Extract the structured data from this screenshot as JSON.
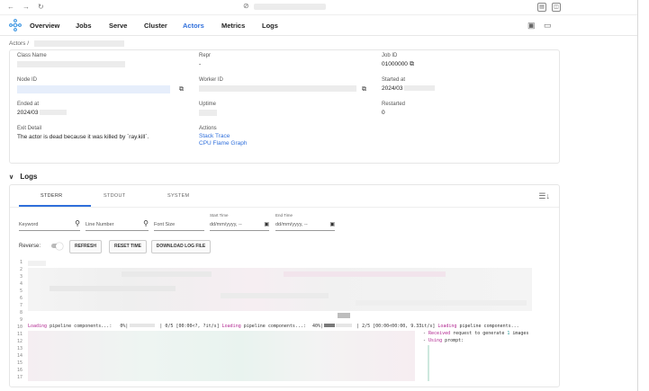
{
  "nav": {
    "tabs": [
      {
        "label": "Overview"
      },
      {
        "label": "Jobs"
      },
      {
        "label": "Serve"
      },
      {
        "label": "Cluster"
      },
      {
        "label": "Actors"
      },
      {
        "label": "Metrics"
      },
      {
        "label": "Logs"
      }
    ],
    "active": "Actors"
  },
  "breadcrumb": {
    "root": "Actors",
    "sep": "/"
  },
  "actor": {
    "class_name_label": "Class Name",
    "repr_label": "Repr",
    "repr_value": "-",
    "job_id_label": "Job ID",
    "job_id_value": "01000000",
    "node_id_label": "Node ID",
    "worker_id_label": "Worker ID",
    "started_at_label": "Started at",
    "started_at_value": "2024/03",
    "ended_at_label": "Ended at",
    "ended_at_value": "2024/03",
    "uptime_label": "Uptime",
    "restarted_label": "Restarted",
    "restarted_value": "0",
    "exit_detail_label": "Exit Detail",
    "exit_detail_value": "The actor is dead because it was killed by `ray.kill`.",
    "actions_label": "Actions",
    "action_stack_trace": "Stack Trace",
    "action_flame_graph": "CPU Flame Graph"
  },
  "logs": {
    "section_title": "Logs",
    "tabs": [
      "STDERR",
      "STDOUT",
      "SYSTEM"
    ],
    "filters": {
      "keyword_placeholder": "Keyword",
      "line_number_placeholder": "Line Number",
      "font_size_placeholder": "Font Size",
      "start_time_label": "Start Time",
      "start_time_value": "dd/mm/yyyy, --",
      "end_time_label": "End Time",
      "end_time_value": "dd/mm/yyyy, --"
    },
    "reverse_label": "Reverse:",
    "buttons": {
      "refresh": "REFRESH",
      "reset_time": "RESET TIME",
      "download": "DOWNLOAD LOG FILE"
    },
    "line_numbers": [
      "1",
      "2",
      "3",
      "4",
      "5",
      "6",
      "7",
      "8",
      "9",
      "10",
      "11",
      "12",
      "13",
      "14",
      "15",
      "16",
      "17"
    ],
    "line10": {
      "seg1_mag": "Loading",
      "seg1_rest": " pipeline components...:",
      "seg2": "0%|",
      "seg3": "| 0/5 [00:00<?, ?it/s]",
      "seg4_mag": "Loading",
      "seg4_rest": " pipeline components...:",
      "seg5": "40%|",
      "seg6": "| 2/5 [00:00<00:00, 9.33it/s]",
      "seg7_mag": "Loading",
      "seg7_rest": " pipeline components..."
    },
    "line11": {
      "prefix": "- ",
      "mag": "Received",
      "rest": " request to generate ",
      "num": "1",
      "tail": " images"
    },
    "line12": {
      "prefix": "- ",
      "mag": "Using",
      "rest": " prompt:"
    }
  }
}
